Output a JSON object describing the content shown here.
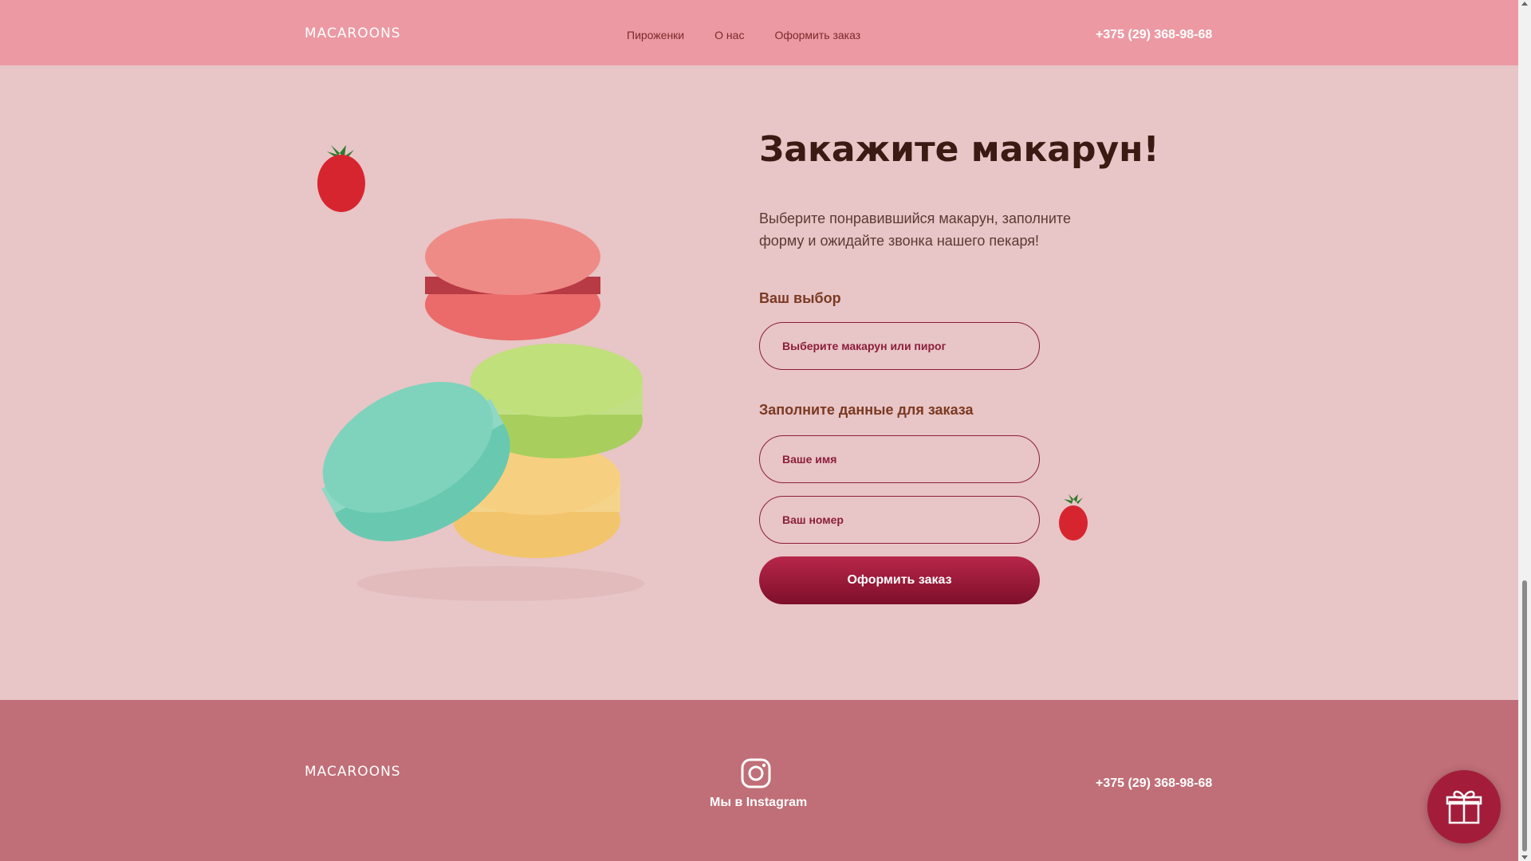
{
  "header": {
    "logo": "MACAROONS",
    "nav": [
      "Пироженки",
      "О нас",
      "Оформить заказ"
    ],
    "phone": "+375 (29) 368-98-68"
  },
  "order": {
    "title": "Закажите макарун!",
    "subtitle": "Выберите понравившийся макарун, заполните форму и ожидайте звонка нашего пекаря!",
    "choice_label": "Ваш выбор",
    "choice_placeholder": "Выберите макарун или пирог",
    "data_label": "Заполните данные для заказа",
    "name_placeholder": "Ваше имя",
    "phone_placeholder": "Ваш номер",
    "submit_label": "Оформить заказ"
  },
  "footer": {
    "logo": "MACAROONS",
    "instagram_label": "Мы в Instagram",
    "phone": "+375 (29) 368-98-68"
  },
  "colors": {
    "header_bg": "#ec99a3",
    "page_bg": "#e8c5c6",
    "footer_bg": "#c06e77",
    "accent": "#8b1f3b"
  },
  "icons": [
    "instagram-icon",
    "gift-icon"
  ]
}
